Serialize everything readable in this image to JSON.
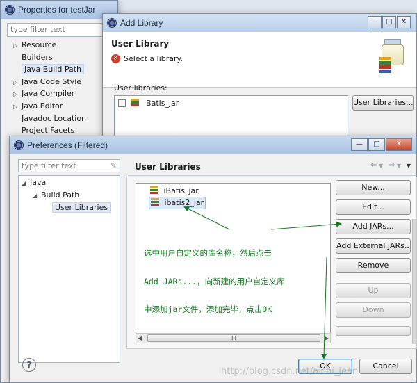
{
  "properties_window": {
    "title": "Properties for testJar",
    "filter_placeholder": "type filter text",
    "tree": [
      {
        "label": "Resource",
        "expandable": true
      },
      {
        "label": "Builders",
        "expandable": false
      },
      {
        "label": "Java Build Path",
        "expandable": false,
        "selected": true
      },
      {
        "label": "Java Code Style",
        "expandable": true
      },
      {
        "label": "Java Compiler",
        "expandable": true
      },
      {
        "label": "Java Editor",
        "expandable": true
      },
      {
        "label": "Javadoc Location",
        "expandable": false
      },
      {
        "label": "Project Facets",
        "expandable": false
      }
    ]
  },
  "add_library_window": {
    "title": "Add Library",
    "banner_title": "User Library",
    "banner_message": "Select a library.",
    "user_libraries_label": "User libraries:",
    "libraries": [
      {
        "label": "iBatis_jar",
        "checked": false
      }
    ],
    "user_libraries_button": "User Libraries..."
  },
  "preferences_window": {
    "title": "Preferences (Filtered)",
    "filter_placeholder": "type filter text",
    "tree": {
      "root": "Java",
      "child": "Build Path",
      "leaf": "User Libraries"
    },
    "section_title": "User Libraries",
    "libraries": [
      "iBatis_jar",
      "ibatis2_jar"
    ],
    "selected_library": "ibatis2_jar",
    "buttons": {
      "new": "New...",
      "edit": "Edit...",
      "add_jars": "Add JARs...",
      "add_external_jars": "Add External JARs...",
      "remove": "Remove",
      "up": "Up",
      "down": "Down"
    },
    "scroll_grip": "III",
    "ok": "OK",
    "cancel": "Cancel",
    "help": "?"
  },
  "annotation": {
    "lines": [
      "选中用户自定义的库名称，然后点击",
      "Add JARs...，向新建的用户自定义库",
      "中添加jar文件，添加完毕，点击OK"
    ],
    "color": "#117a1e"
  },
  "watermark": "http://blog.csdn.net/aichi_jean"
}
